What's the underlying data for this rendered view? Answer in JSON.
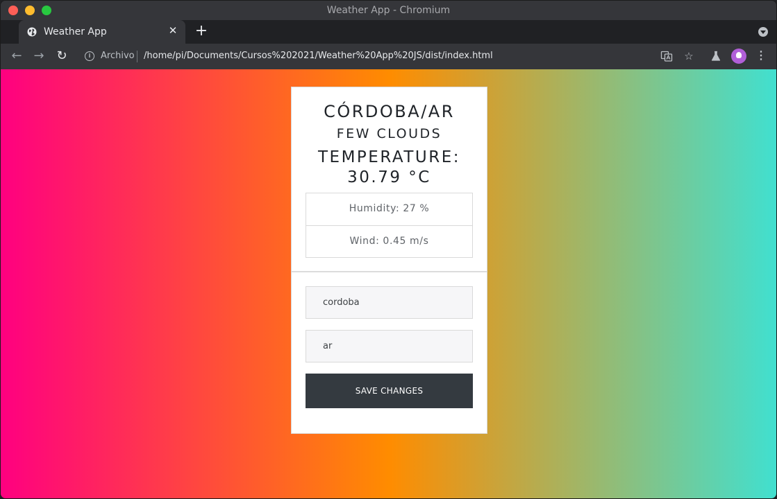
{
  "window": {
    "title": "Weather App - Chromium"
  },
  "tab": {
    "title": "Weather App",
    "globe_icon": "globe-icon",
    "close_glyph": "✕"
  },
  "toolbar": {
    "back_glyph": "←",
    "forward_glyph": "→",
    "reload_glyph": "↻",
    "origin_label": "Archivo",
    "url": "/home/pi/Documents/Cursos%202021/Weather%20App%20JS/dist/index.html",
    "new_tab_glyph": "+",
    "star_glyph": "☆",
    "kebab_glyph": "⋮"
  },
  "weather": {
    "location": "CÓRDOBA/AR",
    "description": "FEW CLOUDS",
    "temperature_label": "TEMPERATURE:",
    "temperature_value": "30.79 °C",
    "humidity": "Humidity: 27 %",
    "wind": "Wind: 0.45 m/s"
  },
  "form": {
    "city_value": "cordoba",
    "country_value": "ar",
    "save_label": "SAVE CHANGES"
  },
  "colors": {
    "gradient_start": "#ff0080",
    "gradient_mid": "#ff8c00",
    "gradient_end": "#40e0d0",
    "button": "#343a40"
  }
}
